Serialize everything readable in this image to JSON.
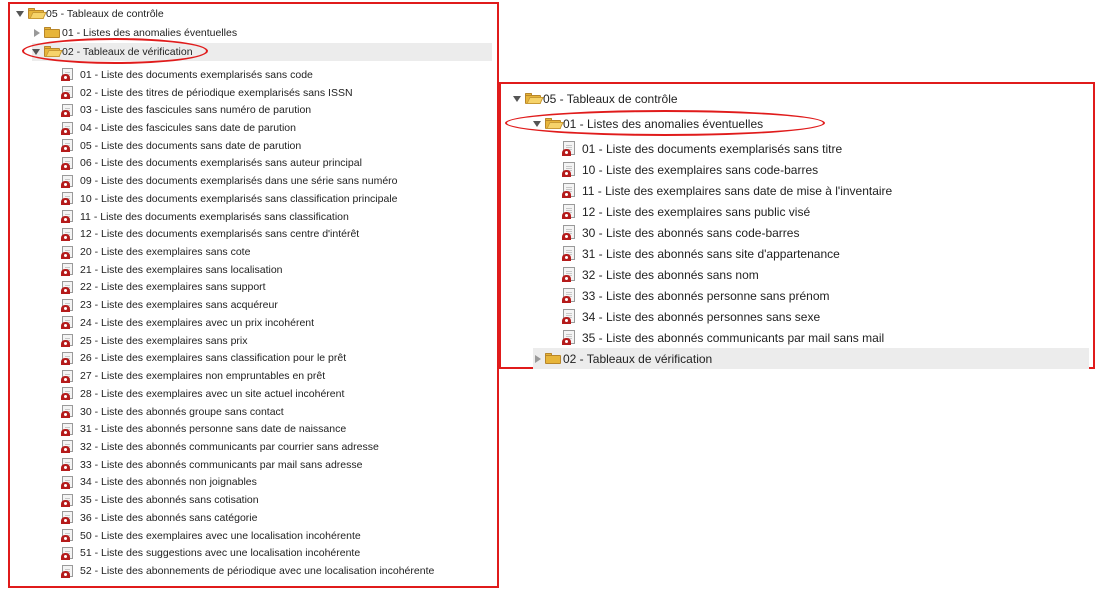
{
  "colors": {
    "annotation_red": "#e01b1b",
    "folder_yellow": "#e7b53a",
    "report_icon_red": "#b51b1b",
    "selected_row": "#ececec"
  },
  "panel_left": {
    "root_label": "05 - Tableaux de contrôle",
    "collapsed_folder_label": "01 - Listes des anomalies éventuelles",
    "expanded_folder_label": "02 - Tableaux de vérification",
    "items": [
      "01 - Liste des documents exemplarisés sans code",
      "02 - Liste des titres de périodique exemplarisés sans ISSN",
      "03 - Liste des fascicules sans numéro de parution",
      "04 - Liste des fascicules sans date de parution",
      "05 - Liste des documents sans date de parution",
      "06 - Liste des documents exemplarisés sans auteur principal",
      "09 - Liste des documents exemplarisés dans une série sans numéro",
      "10 - Liste des documents exemplarisés sans classification principale",
      "11 - Liste des documents exemplarisés sans classification",
      "12 - Liste des documents exemplarisés sans centre d'intérêt",
      "20 - Liste des exemplaires sans cote",
      "21 - Liste des exemplaires sans localisation",
      "22 - Liste des exemplaires sans support",
      "23 - Liste des exemplaires sans acquéreur",
      "24 - Liste des exemplaires avec un prix incohérent",
      "25 - Liste des exemplaires sans prix",
      "26 - Liste des exemplaires sans classification pour le prêt",
      "27 - Liste des exemplaires non empruntables en prêt",
      "28 - Liste des exemplaires avec un site actuel incohérent",
      "30 - Liste des abonnés groupe sans contact",
      "31 - Liste des abonnés personne sans date de naissance",
      "32 - Liste des abonnés communicants par courrier sans adresse",
      "33 - Liste des abonnés communicants par mail sans adresse",
      "34 - Liste des abonnés non joignables",
      "35 - Liste des abonnés sans cotisation",
      "36 - Liste des abonnés sans catégorie",
      "50 - Liste des exemplaires avec une localisation incohérente",
      "51 - Liste des suggestions avec une localisation incohérente",
      "52 - Liste des abonnements de périodique avec une localisation incohérente"
    ]
  },
  "panel_right": {
    "root_label": "05 - Tableaux de contrôle",
    "expanded_folder_label": "01 - Listes des anomalies éventuelles",
    "collapsed_folder_label": "02 - Tableaux de vérification",
    "items": [
      "01 - Liste des documents exemplarisés sans titre",
      "10 - Liste des exemplaires sans code-barres",
      "11 - Liste des exemplaires sans date de mise à l'inventaire",
      "12 - Liste des exemplaires sans public visé",
      "30 - Liste des abonnés sans code-barres",
      "31 - Liste des abonnés sans site d'appartenance",
      "32 - Liste des abonnés sans nom",
      "33 - Liste des abonnés personne sans prénom",
      "34 - Liste des abonnés personnes sans sexe",
      "35 - Liste des abonnés communicants par mail sans mail"
    ]
  }
}
